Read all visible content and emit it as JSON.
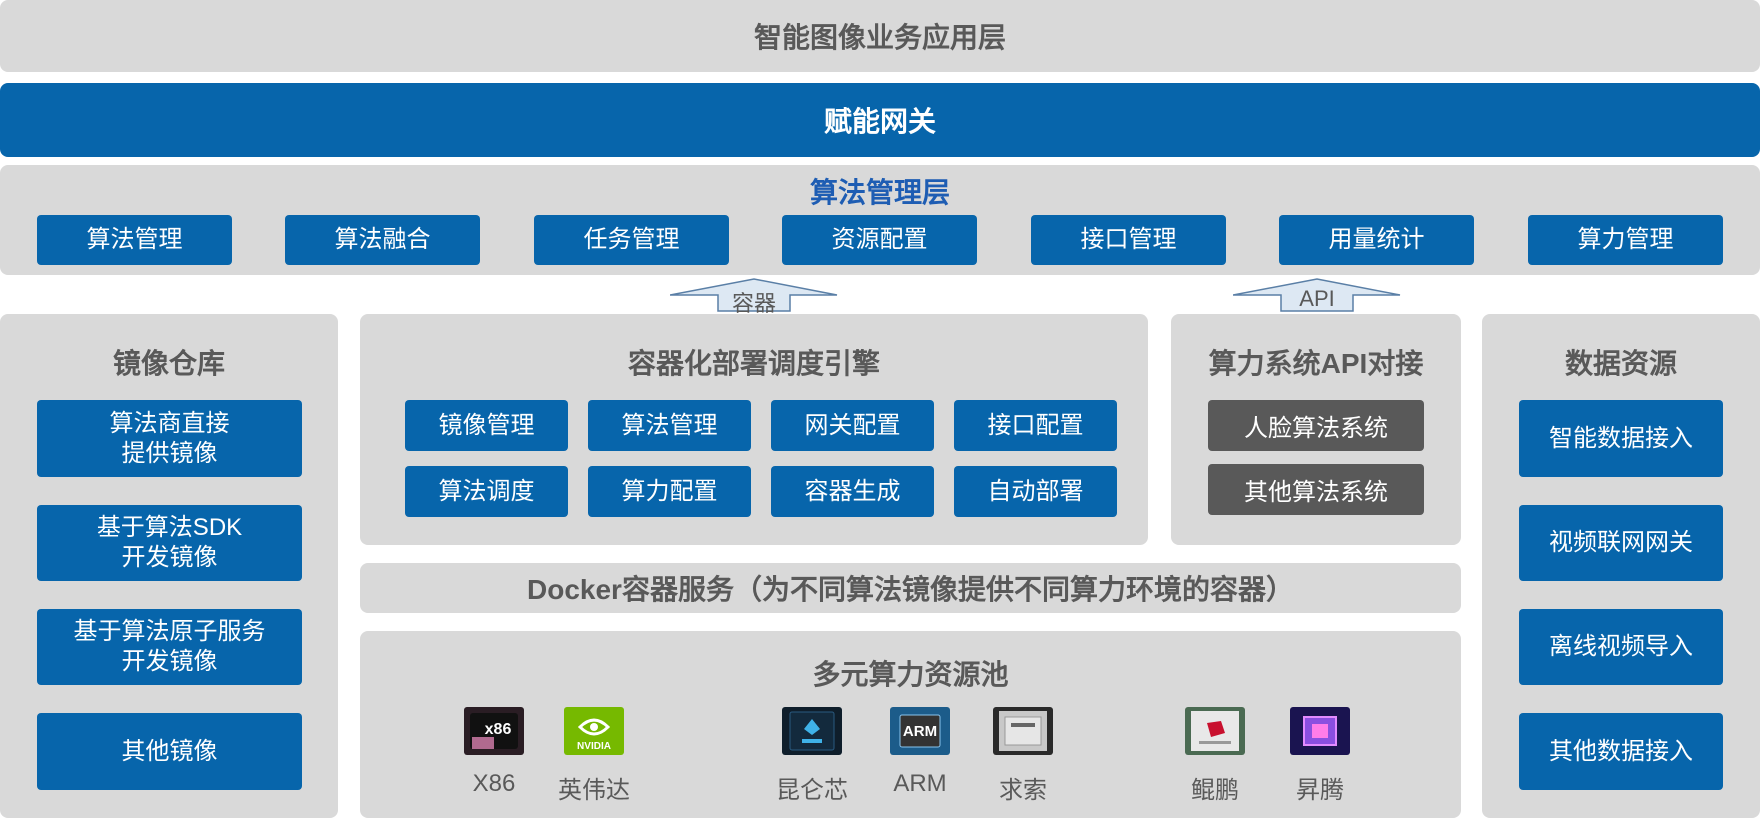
{
  "top_layer": {
    "title": "智能图像业务应用层"
  },
  "gateway": {
    "title": "赋能网关"
  },
  "algo_mgmt_layer": {
    "title": "算法管理层",
    "items": [
      "算法管理",
      "算法融合",
      "任务管理",
      "资源配置",
      "接口管理",
      "用量统计",
      "算力管理"
    ]
  },
  "arrows": {
    "container": "容器",
    "api": "API"
  },
  "image_repo": {
    "title": "镜像仓库",
    "items": [
      "算法商直接\n提供镜像",
      "基于算法SDK\n开发镜像",
      "基于算法原子服务\n开发镜像",
      "其他镜像"
    ]
  },
  "container_engine": {
    "title": "容器化部署调度引擎",
    "items": [
      "镜像管理",
      "算法管理",
      "网关配置",
      "接口配置",
      "算法调度",
      "算力配置",
      "容器生成",
      "自动部署"
    ]
  },
  "compute_api": {
    "title": "算力系统API对接",
    "items": [
      "人脸算法系统",
      "其他算法系统"
    ]
  },
  "data_resources": {
    "title": "数据资源",
    "items": [
      "智能数据接入",
      "视频联网网关",
      "离线视频导入",
      "其他数据接入"
    ]
  },
  "docker": {
    "title": "Docker容器服务（为不同算法镜像提供不同算力环境的容器）"
  },
  "compute_pool": {
    "title": "多元算力资源池",
    "chips": [
      {
        "label": "X86",
        "icon": "x86-chip-icon"
      },
      {
        "label": "英伟达",
        "icon": "nvidia-logo-icon"
      },
      {
        "label": "昆仑芯",
        "icon": "kunlun-chip-icon"
      },
      {
        "label": "ARM",
        "icon": "arm-chip-icon"
      },
      {
        "label": "求索",
        "icon": "qiusuo-chip-icon"
      },
      {
        "label": "鲲鹏",
        "icon": "kunpeng-chip-icon"
      },
      {
        "label": "昇腾",
        "icon": "ascend-chip-icon"
      }
    ]
  },
  "colors": {
    "panel": "#d9d9d9",
    "blue": "#0765ab",
    "dark": "#595959",
    "title_blue": "#1e5db3"
  }
}
